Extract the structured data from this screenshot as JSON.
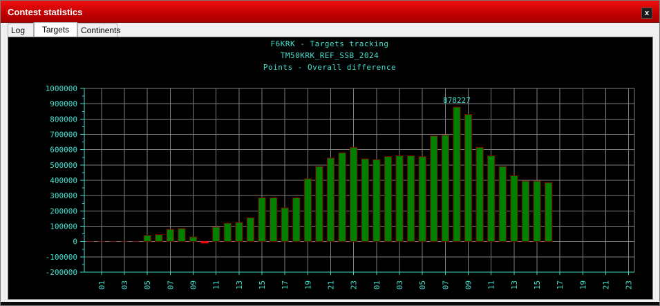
{
  "window": {
    "title": "Contest statistics",
    "close_label": "x"
  },
  "tabs": [
    {
      "label": "Log",
      "active": false
    },
    {
      "label": "Targets",
      "active": true
    },
    {
      "label": "Continents",
      "active": false
    }
  ],
  "colors": {
    "titlebar": "#d00000",
    "chart_bg": "#000000",
    "text": "#40e0d0",
    "grid": "#808080",
    "bar": "#008000",
    "bar_outline": "#800000",
    "negative": "#ff0000"
  },
  "chart_data": {
    "type": "bar",
    "title": "F6KRK - Targets tracking",
    "subtitle": "TM50KRK_REF_SSB_2024",
    "subtitle2": "Points - Overall difference",
    "ylim": [
      -200000,
      1000000
    ],
    "yticks": [
      "1000000",
      "900000",
      "800000",
      "700000",
      "600000",
      "500000",
      "400000",
      "300000",
      "200000",
      "100000",
      "0",
      "-100000",
      "-200000"
    ],
    "x_tick_labels": [
      "01",
      "03",
      "05",
      "07",
      "09",
      "11",
      "13",
      "15",
      "17",
      "19",
      "21",
      "23",
      "01",
      "03",
      "05",
      "07",
      "09",
      "11",
      "13",
      "15",
      "17",
      "19",
      "21",
      "23"
    ],
    "peak_label": "878227",
    "values": [
      0,
      0,
      0,
      0,
      0,
      40000,
      45000,
      80000,
      85000,
      30000,
      -10000,
      95000,
      120000,
      125000,
      155000,
      285000,
      285000,
      220000,
      285000,
      410000,
      490000,
      545000,
      580000,
      615000,
      540000,
      535000,
      555000,
      560000,
      560000,
      555000,
      690000,
      695000,
      878227,
      830000,
      615000,
      560000,
      490000,
      430000,
      395000,
      395000,
      385000,
      null,
      null,
      null,
      null,
      null,
      null,
      null
    ]
  }
}
